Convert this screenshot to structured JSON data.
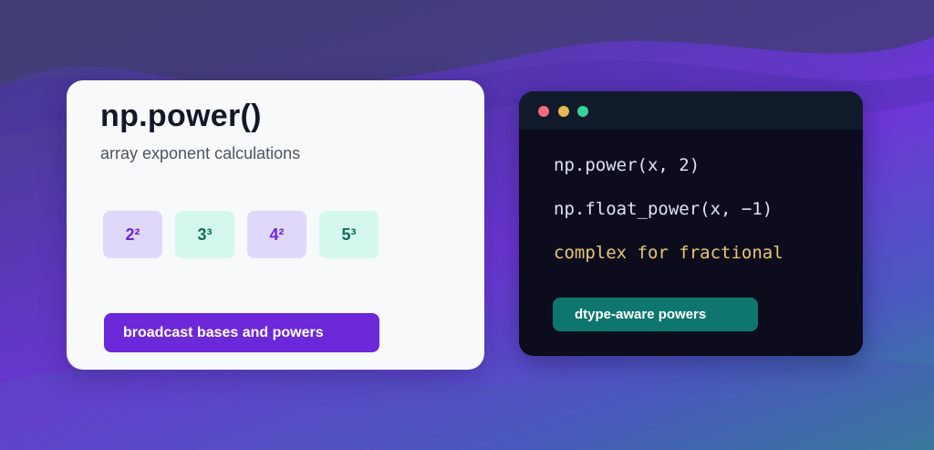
{
  "colors": {
    "accent_purple": "#6d28d9",
    "accent_teal": "#0f766e",
    "terminal_bg": "#0c0c1d",
    "code_highlight": "#e7c873"
  },
  "left_card": {
    "title": "np.power()",
    "subtitle": "array exponent calculations",
    "tiles": [
      {
        "label": "2²",
        "style": "purple"
      },
      {
        "label": "3³",
        "style": "mint"
      },
      {
        "label": "4²",
        "style": "purple"
      },
      {
        "label": "5³",
        "style": "mint"
      }
    ],
    "button_label": "broadcast bases and powers"
  },
  "right_card": {
    "window_dots": [
      "close-dot-icon",
      "minimize-dot-icon",
      "maximize-dot-icon"
    ],
    "code_lines": [
      "np.power(x, 2)",
      "np.float_power(x, −1)",
      "complex for fractional"
    ],
    "badge_label": "dtype-aware powers"
  }
}
